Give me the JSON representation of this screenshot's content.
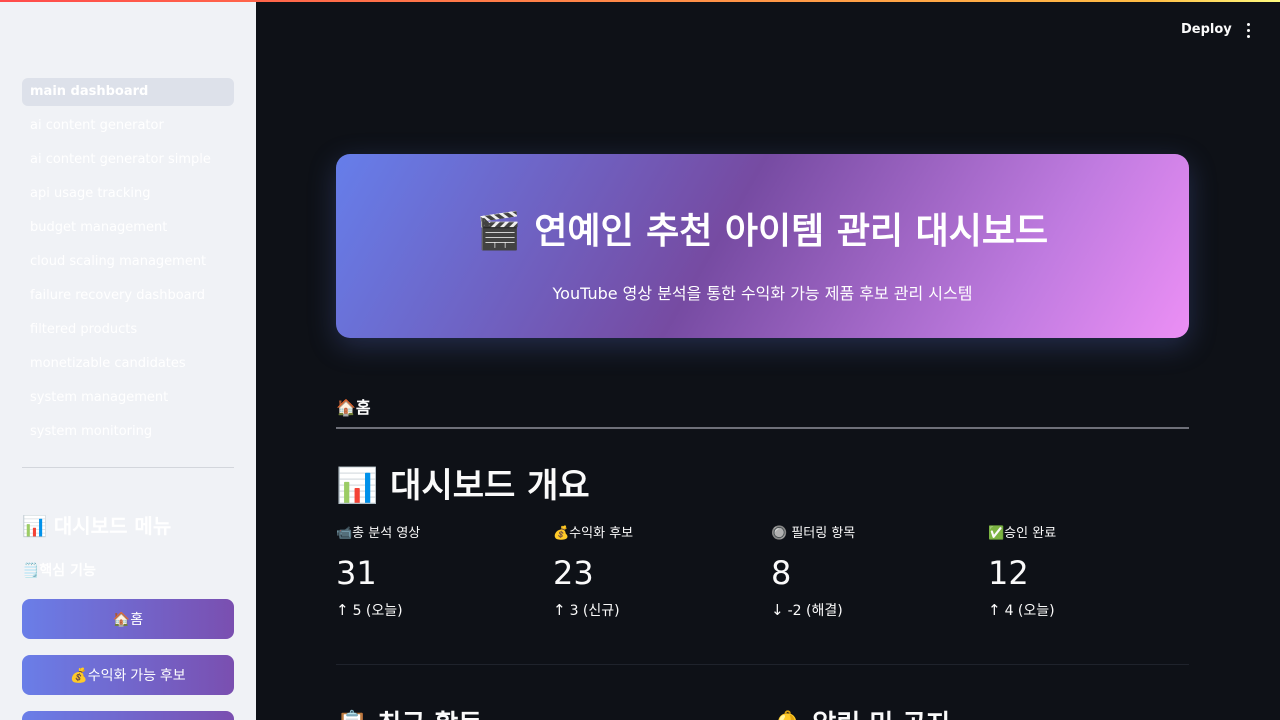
{
  "nav": {
    "items": [
      {
        "label": "main dashboard",
        "active": true
      },
      {
        "label": "ai content generator"
      },
      {
        "label": "ai content generator simple"
      },
      {
        "label": "api usage tracking"
      },
      {
        "label": "budget management"
      },
      {
        "label": "cloud scaling management"
      },
      {
        "label": "failure recovery dashboard"
      },
      {
        "label": "filtered products"
      },
      {
        "label": "monetizable candidates"
      },
      {
        "label": "system management"
      },
      {
        "label": "system monitoring"
      }
    ]
  },
  "sidebar": {
    "menu_title": "📊 대시보드 메뉴",
    "core_label": "🗒️핵심 기능",
    "buttons": [
      "🏠홈",
      "💰수익화 가능 후보",
      ""
    ]
  },
  "header": {
    "deploy_label": "Deploy",
    "menu_icon": "kebab-menu-icon"
  },
  "hero": {
    "title": "🎬 연예인 추천 아이템 관리 대시보드",
    "subtitle": "YouTube 영상 분석을 통한 수익화 가능 제품 후보 관리 시스템"
  },
  "breadcrumb": "🏠홈",
  "overview": {
    "title": "📊 대시보드 개요",
    "metrics": [
      {
        "label": "📹총 분석 영상",
        "value": "31",
        "delta": "5 (오늘)",
        "direction": "up"
      },
      {
        "label": "💰수익화 후보",
        "value": "23",
        "delta": "3 (신규)",
        "direction": "up"
      },
      {
        "label": "🔘 필터링 항목",
        "value": "8",
        "delta": "-2 (해결)",
        "direction": "down"
      },
      {
        "label": "✅승인 완료",
        "value": "12",
        "delta": "4 (오늘)",
        "direction": "up"
      }
    ]
  },
  "sections": {
    "recent": "📋 최근 활동",
    "alerts": "🔔 알림 및 공지"
  },
  "colors": {
    "accent_start": "#667eea",
    "accent_end": "#764ba2",
    "bg": "#0e1117"
  }
}
